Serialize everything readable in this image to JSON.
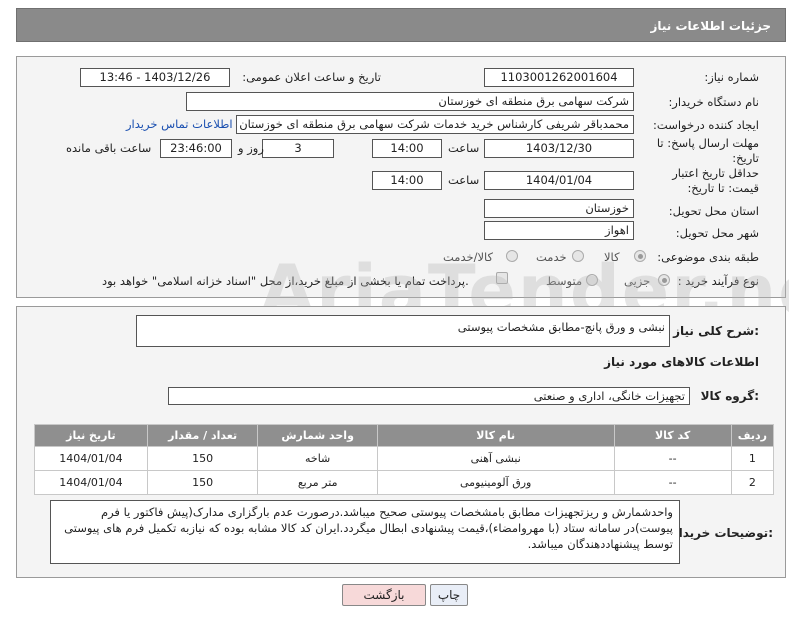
{
  "header": {
    "title": "جزئیات اطلاعات نیاز"
  },
  "form": {
    "need_number_label": "شماره نیاز:",
    "need_number": "1103001262001604",
    "announce_label": "تاریخ و ساعت اعلان عمومی:",
    "announce_value": "1403/12/26 - 13:46",
    "buyer_org_label": "نام دستگاه خریدار:",
    "buyer_org": "شرکت سهامی برق منطقه ای خوزستان",
    "requester_label": "ایجاد کننده درخواست:",
    "requester": "محمدباقر شریفی کارشناس خرید خدمات شرکت سهامی برق منطقه ای خوزستان",
    "contact_link": "اطلاعات تماس خریدار",
    "deadline_label": "مهلت ارسال پاسخ: تا تاریخ:",
    "deadline_date": "1403/12/30",
    "time_label": "ساعت",
    "deadline_time": "14:00",
    "days_value": "3",
    "days_label": "روز و",
    "remaining_time": "23:46:00",
    "remaining_label": "ساعت باقی مانده",
    "validity_label": "حداقل تاریخ اعتبار قیمت: تا تاریخ:",
    "validity_date": "1404/01/04",
    "validity_time": "14:00",
    "province_label": "استان محل تحویل:",
    "province": "خوزستان",
    "city_label": "شهر محل تحویل:",
    "city": "اهواز",
    "category_label": "طبقه بندی موضوعی:",
    "category_options": [
      "کالا",
      "خدمت",
      "کالا/خدمت"
    ],
    "process_label": "نوع فرآیند خرید :",
    "process_options": [
      "جزیی",
      "متوسط"
    ],
    "payment_note": "پرداخت تمام یا بخشی از مبلغ خرید،از محل \"اسناد خزانه اسلامی\" خواهد بود."
  },
  "section2": {
    "summary_label": "شرح کلی نیاز:",
    "summary": "نبشی و ورق پانچ-مطابق مشخصات پیوستی",
    "goods_info_title": "اطلاعات کالاهای مورد نیاز",
    "group_label": "گروه کالا:",
    "group_value": "تجهیزات خانگی، اداری و صنعتی",
    "table": {
      "headers": [
        "ردیف",
        "کد کالا",
        "نام کالا",
        "واحد شمارش",
        "تعداد / مقدار",
        "تاریخ نیاز"
      ],
      "rows": [
        [
          "1",
          "--",
          "نبشی آهنی",
          "شاخه",
          "150",
          "1404/01/04"
        ],
        [
          "2",
          "--",
          "ورق آلومینیومی",
          "متر مربع",
          "150",
          "1404/01/04"
        ]
      ]
    },
    "buyer_notes_label": "توضیحات خریدار:",
    "buyer_notes": "واحدشمارش و ریزتجهیزات مطابق بامشخصات پیوستی صحیح میباشد.درصورت عدم بارگزاری مدارک(پیش فاکتور یا فرم پیوست)در سامانه ستاد (با مهروامضاء)،قیمت پیشنهادی ابطال میگردد.ایران کد کالا مشابه بوده که نیازبه تکمیل فرم های پیوستی توسط پیشنهاددهندگان میباشد."
  },
  "buttons": {
    "print": "چاپ",
    "back": "بازگشت"
  },
  "watermark": "AriaTender.neT",
  "colors": {
    "header_bg": "#8a8a8a",
    "link": "#1a4fb0",
    "back_btn_bg": "#f7d9d9",
    "print_btn_bg": "#e9eef7"
  }
}
